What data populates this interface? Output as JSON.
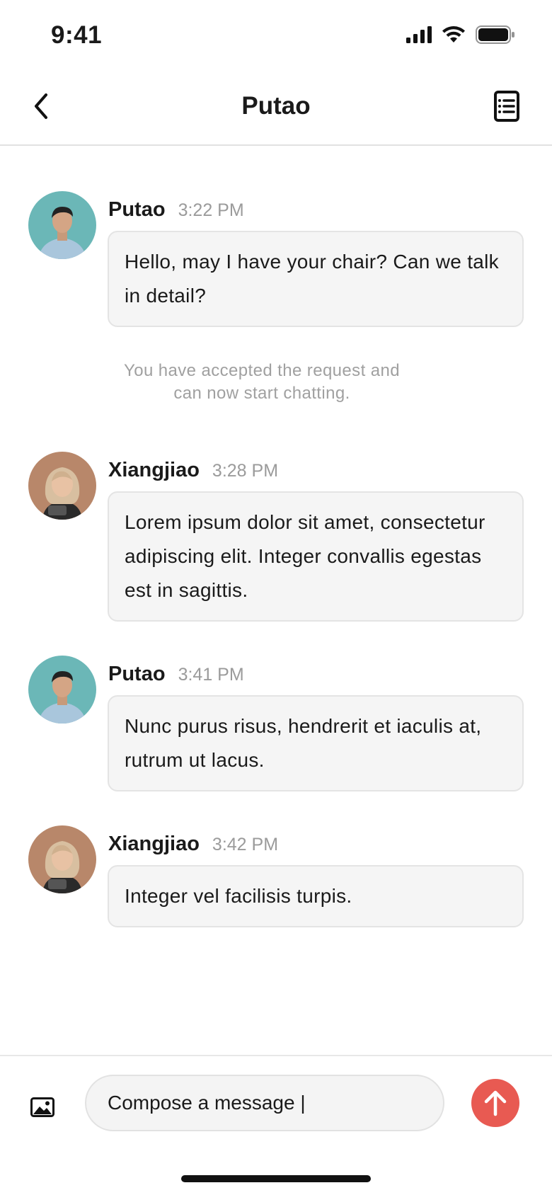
{
  "status_bar": {
    "time": "9:41"
  },
  "nav": {
    "title": "Putao"
  },
  "messages": [
    {
      "name": "Putao",
      "time": "3:22 PM",
      "text": "Hello, may I have your chair? Can we talk in detail?"
    },
    {
      "name": "Xiangjiao",
      "time": "3:28 PM",
      "text": "Lorem ipsum dolor sit amet, consectetur adipiscing elit. Integer convallis egestas est in sagittis."
    },
    {
      "name": "Putao",
      "time": "3:41 PM",
      "text": "Nunc purus risus, hendrerit et iaculis at, rutrum ut lacus."
    },
    {
      "name": "Xiangjiao",
      "time": "3:42 PM",
      "text": "Integer vel facilisis turpis."
    }
  ],
  "system_note": {
    "text": "You have accepted the request and can now start chatting."
  },
  "composer": {
    "value": "Compose a message |"
  },
  "colors": {
    "accent": "#e85a52",
    "bubble_bg": "#f5f5f5",
    "muted_text": "#9b9b9b",
    "avatar_putao_bg": "#6bb7b7",
    "avatar_xiangjiao_bg": "#b8876a"
  },
  "icons": {
    "back": "chevron-left-icon",
    "document": "document-list-icon",
    "image": "image-icon",
    "send": "arrow-up-icon"
  }
}
